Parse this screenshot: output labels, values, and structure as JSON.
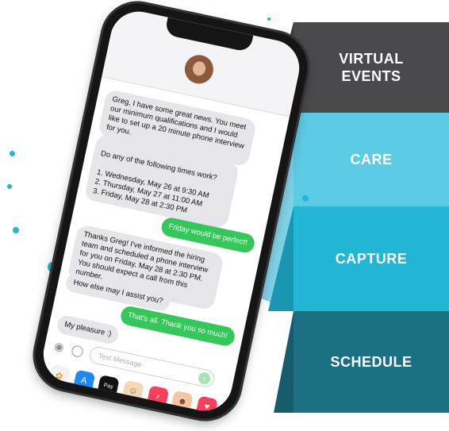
{
  "steps": [
    {
      "label": "VIRTUAL EVENTS"
    },
    {
      "label": "CARE"
    },
    {
      "label": "CAPTURE"
    },
    {
      "label": "SCHEDULE"
    }
  ],
  "messages": [
    {
      "from": "in",
      "text": "Greg, I have some great news. You meet our minimum qualifications and I would like to set up a 20 minute phone interview for you."
    },
    {
      "from": "in",
      "text": "Do any of the following times work?\n\n1. Wednesday, May 26 at 9:30 AM\n2. Thursday, May 27 at 11:00 AM\n3. Friday, May 28 at 2:30 PM"
    },
    {
      "from": "out",
      "text": "Friday would be perfect!"
    },
    {
      "from": "in",
      "text": "Thanks Greg! I've informed the hiring team and scheduled a phone interview for you on Friday, May 28 at 2:30 PM. You should expect a call from this number."
    },
    {
      "from": "in",
      "text": "How else may I assist you?"
    },
    {
      "from": "out",
      "text": "That's all. Thank you so much!"
    },
    {
      "from": "in",
      "text": "My pleasure :)"
    }
  ],
  "input": {
    "placeholder": "Text Message"
  },
  "dock": [
    {
      "icon": "photos-icon",
      "color": "#f2f2f2",
      "glyph": "✿"
    },
    {
      "icon": "app-store-icon",
      "color": "#1e88f5",
      "glyph": "A"
    },
    {
      "icon": "apple-pay-icon",
      "color": "#111111",
      "glyph": "Pay"
    },
    {
      "icon": "memoji-icon",
      "color": "#f5d7b5",
      "glyph": "☺"
    },
    {
      "icon": "music-icon",
      "color": "#fa3e5c",
      "glyph": "♪"
    },
    {
      "icon": "memoji-icon-2",
      "color": "#f4c6a0",
      "glyph": "☻"
    },
    {
      "icon": "heart-icon",
      "color": "#fa3e5c",
      "glyph": "♥"
    }
  ]
}
